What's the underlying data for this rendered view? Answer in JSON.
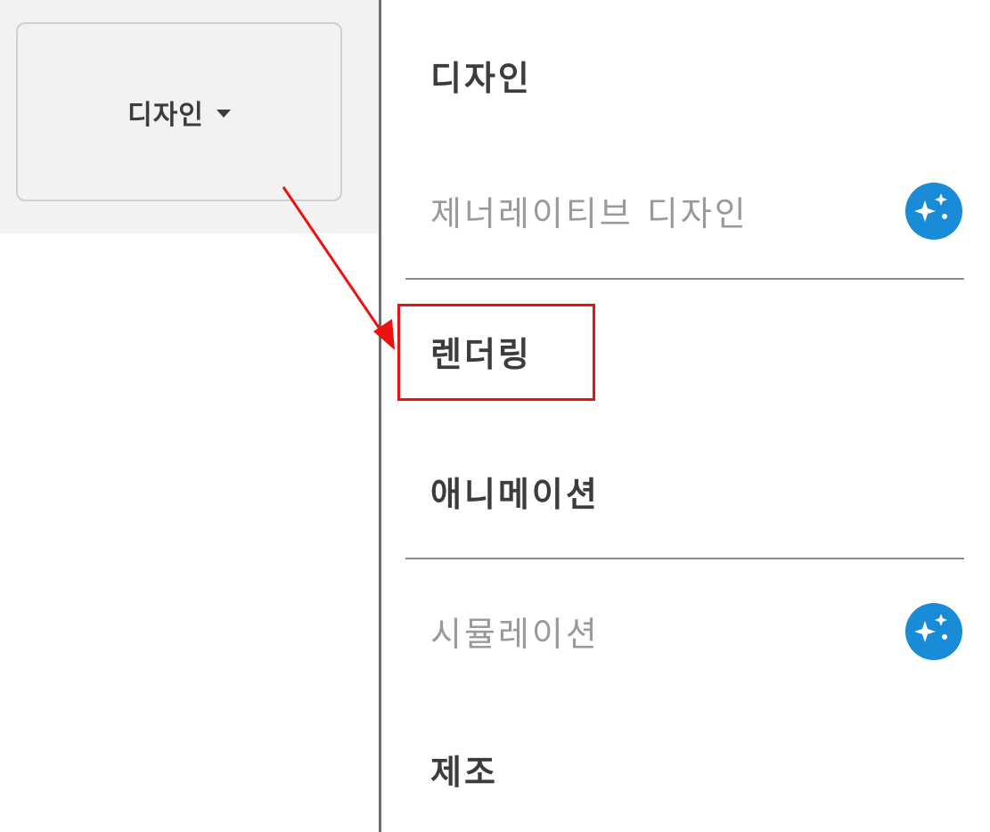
{
  "dropdown": {
    "label": "디자인",
    "caret_icon": "caret-down-icon"
  },
  "menu": {
    "items": [
      {
        "label": "디자인",
        "enabled": true
      },
      {
        "label": "제너레이티브 디자인",
        "enabled": false,
        "badge_icon": "ai-sparkle-icon"
      },
      {
        "label": "렌더링",
        "enabled": true,
        "highlighted": true
      },
      {
        "label": "애니메이션",
        "enabled": true
      },
      {
        "label": "시뮬레이션",
        "enabled": false,
        "badge_icon": "ai-sparkle-icon"
      },
      {
        "label": "제조",
        "enabled": true
      }
    ]
  },
  "colors": {
    "annotation": "#ee1111",
    "badge": "#1a8bd6",
    "enabled_text": "#3c3c3c",
    "disabled_text": "#9a9a9a"
  }
}
